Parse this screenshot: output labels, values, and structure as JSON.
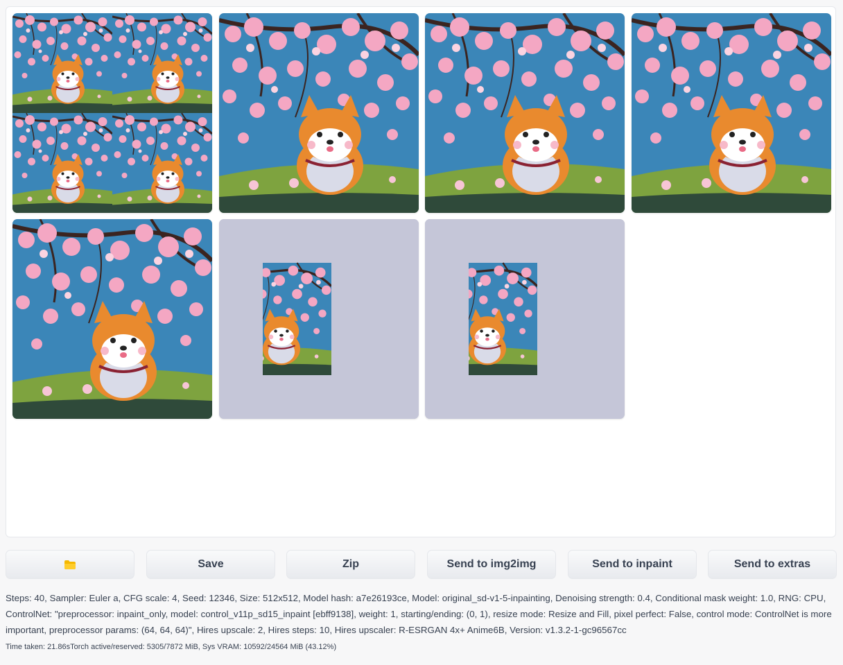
{
  "gallery": {
    "images": [
      {
        "kind": "grid",
        "alt": ""
      },
      {
        "kind": "full",
        "alt": ""
      },
      {
        "kind": "full",
        "alt": ""
      },
      {
        "kind": "full",
        "alt": ""
      },
      {
        "kind": "full",
        "alt": ""
      },
      {
        "kind": "narrow",
        "alt": ""
      },
      {
        "kind": "narrow",
        "alt": ""
      }
    ]
  },
  "toolbar": {
    "folder_icon": "folder-icon",
    "save_label": "Save",
    "zip_label": "Zip",
    "img2img_label": "Send to img2img",
    "inpaint_label": "Send to inpaint",
    "extras_label": "Send to extras"
  },
  "info": {
    "params": "Steps: 40, Sampler: Euler a, CFG scale: 4, Seed: 12346, Size: 512x512, Model hash: a7e26193ce, Model: original_sd-v1-5-inpainting, Denoising strength: 0.4, Conditional mask weight: 1.0, RNG: CPU, ControlNet: \"preprocessor: inpaint_only, model: control_v11p_sd15_inpaint [ebff9138], weight: 1, starting/ending: (0, 1), resize mode: Resize and Fill, pixel perfect: False, control mode: ControlNet is more important, preprocessor params: (64, 64, 64)\", Hires upscale: 2, Hires steps: 10, Hires upscaler: R-ESRGAN 4x+ Anime6B, Version: v1.3.2-1-gc96567cc",
    "timing": "Time taken: 21.86sTorch active/reserved: 5305/7872 MiB, Sys VRAM: 10592/24564 MiB (43.12%)"
  },
  "colors": {
    "sky": "#3b86b8",
    "blossom": "#f4a7c3",
    "grass": "#7ea33f",
    "dog_orange": "#e98a2e",
    "letterbox": "#c5c6d8"
  }
}
